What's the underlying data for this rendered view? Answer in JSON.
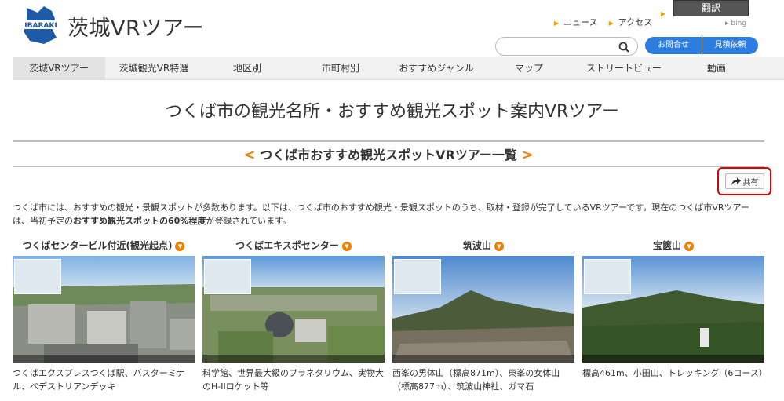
{
  "header": {
    "logo_text": "IBARAKI",
    "site_title": "茨城VRツアー",
    "links": [
      "ニュース",
      "アクセス"
    ],
    "translate_label": "翻訳",
    "bing_label": "bing",
    "search_placeholder": "",
    "contact_label": "お問合せ",
    "estimate_label": "見積依頼",
    "colors": {
      "accent_blue": "#2d7de0",
      "accent_orange": "#f08000"
    }
  },
  "nav": {
    "items": [
      "茨城VRツアー",
      "茨城観光VR特選",
      "地区別",
      "市町村別",
      "おすすめジャンル",
      "マップ",
      "ストリートビュー",
      "動画"
    ],
    "active_index": 0
  },
  "main": {
    "page_title": "つくば市の観光名所・おすすめ観光スポット案内VRツアー",
    "section_title": "つくば市おすすめ観光スポットVRツアー一覧",
    "section_arrow_left": "<",
    "section_arrow_right": ">",
    "share_label": "共有",
    "intro_part1": "つくば市には、おすすめの観光・景観スポットが多数あります。以下は、つくば市のおすすめ観光・景観スポットのうち、取材・登録が完了しているVRツアーです。現在のつくば市VRツアーは、当初予定の",
    "intro_bold": "おすすめ観光スポットの60%程度",
    "intro_part2": "が登録されています。"
  },
  "cards": [
    {
      "title": "つくばセンタービル付近(観光起点)",
      "desc": "つくばエクスプレスつくば駅、バスターミナル、ペデストリアンデッキ"
    },
    {
      "title": "つくばエキスポセンター",
      "desc": "科学館、世界最大級のプラネタリウム、実物大のH-IIロケット等"
    },
    {
      "title": "筑波山",
      "desc": "西峯の男体山（標高871m）、東峯の女体山（標高877m）、筑波山神社、ガマ石"
    },
    {
      "title": "宝篋山",
      "desc": "標高461m、小田山、トレッキング（6コース）"
    }
  ]
}
